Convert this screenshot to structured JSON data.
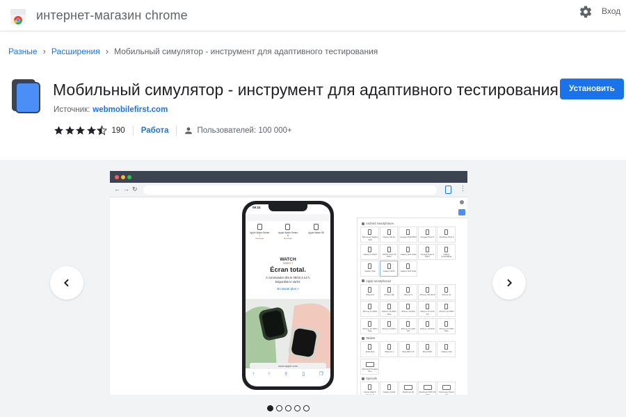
{
  "store": {
    "title": "интернет-магазин chrome",
    "signin_label": "Вход",
    "colors": {
      "accent": "#1a73e8"
    }
  },
  "breadcrumb": {
    "items": [
      "Разные",
      "Расширения",
      "Мобильный симулятор - инструмент для адаптивного тестирования"
    ]
  },
  "extension": {
    "name": "Мобильный симулятор - инструмент для адаптивного тестирования",
    "source_label": "Источник:",
    "source_link": "webmobilefirst.com",
    "install_label": "Установить",
    "rating": 4.5,
    "rating_count": "190",
    "category": "Работа",
    "users": "Пользователей: 100 000+"
  },
  "gallery": {
    "slide_count": 5,
    "active_slide": 1,
    "phone": {
      "time": "09:24",
      "watches": [
        {
          "label": "Apple Watch Series 7",
          "tag": "Nouveau"
        },
        {
          "label": "Apple Watch Series 6",
          "tag": "Nouveau"
        },
        {
          "label": "Apple Watch SE",
          "tag": ""
        }
      ],
      "promo_brand": "WATCH",
      "promo_series": "SERIES 7",
      "promo_title": "Écran total.",
      "promo_sub_1": "À commander dès le 08/10 à 14 h.",
      "promo_sub_2": "Disponible le 15/10.",
      "promo_link": "En savoir plus >",
      "address": "www.apple.com"
    },
    "panel": {
      "categories": [
        {
          "name": "Android smartphones",
          "devices": [
            "Samsung Galaxy S20",
            "Xiaomi Mi 11i",
            "Huawei P40 PRO",
            "Google Pixel 5",
            "OnePlus Nord 2",
            "Galaxy Z Flip3",
            "OPPO Find X3 PRO",
            "Galaxy S21 Ultra",
            "Google Pixel 4 PRO",
            "Galaxy Fold/Tablet",
            "Galaxy S22",
            "Galaxy S22+",
            "Galaxy S22 Ultra"
          ]
        },
        {
          "name": "Apple smartphones",
          "devices": [
            "iPhone 8",
            "iPhone SE",
            "iPhone X",
            "iPhone XR 2019",
            "iPhone 11",
            "iPhone 11 PRO",
            "iPhone 11 PRO Max",
            "iPhone 12 Mini",
            "iPhone 12 (iOS 14)",
            "iPhone 12 PRO",
            "iPhone 12 PRO Max",
            "iPhone 13 Mini",
            "iPhone 13 (iOS 15)",
            "iPhone 13 PRO",
            "iPhone 13 PRO Max"
          ]
        },
        {
          "name": "Tablets",
          "devices": [
            "iPad Mini",
            "iPad Air 4",
            "iPad PRO 11",
            "iPad PRO",
            "Galaxy Tab",
            "Microsoft Surface Duo"
          ]
        },
        {
          "name": "Specials",
          "devices": [
            "Apple Watch Series 6",
            "Galaxy Fold2",
            "Macbook Air",
            "Macbook PRO 16 2021",
            "Samsung Smart TV"
          ]
        }
      ]
    }
  }
}
